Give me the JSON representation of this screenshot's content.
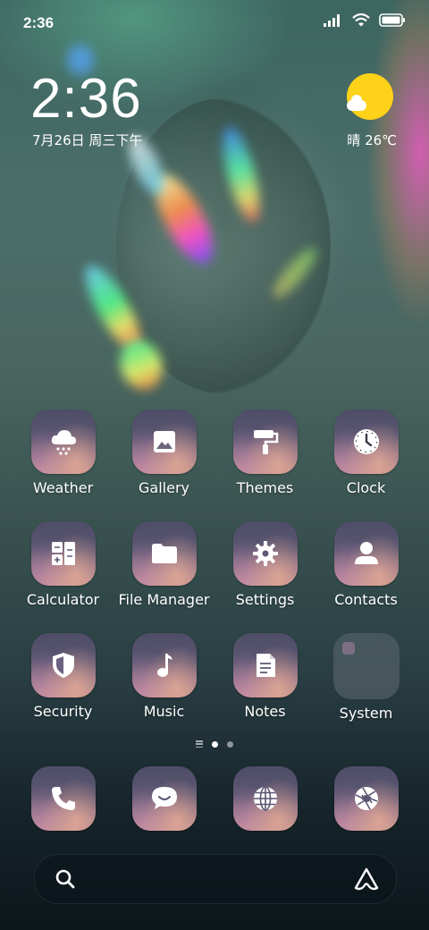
{
  "status_bar": {
    "time": "2:36",
    "icons": [
      "signal-icon",
      "wifi-icon",
      "battery-icon"
    ]
  },
  "clock_widget": {
    "time": "2:36",
    "date": "7月26日 周三下午"
  },
  "weather_widget": {
    "condition_icon": "sun-cloud-icon",
    "text": "晴 26℃"
  },
  "apps": [
    [
      {
        "label": "Weather",
        "icon": "cloud-rain-icon"
      },
      {
        "label": "Gallery",
        "icon": "image-icon"
      },
      {
        "label": "Themes",
        "icon": "paint-roller-icon"
      },
      {
        "label": "Clock",
        "icon": "clock-icon"
      }
    ],
    [
      {
        "label": "Calculator",
        "icon": "calculator-icon"
      },
      {
        "label": "File Manager",
        "icon": "folder-icon"
      },
      {
        "label": "Settings",
        "icon": "gear-icon"
      },
      {
        "label": "Contacts",
        "icon": "person-icon"
      }
    ],
    [
      {
        "label": "Security",
        "icon": "shield-icon"
      },
      {
        "label": "Music",
        "icon": "music-note-icon"
      },
      {
        "label": "Notes",
        "icon": "note-icon"
      },
      {
        "label": "System",
        "icon": "folder-system"
      }
    ]
  ],
  "page_indicator": {
    "pages": 2,
    "active": 1
  },
  "dock": [
    {
      "icon": "phone-icon"
    },
    {
      "icon": "chat-bubble-icon"
    },
    {
      "icon": "globe-icon"
    },
    {
      "icon": "camera-aperture-icon"
    }
  ],
  "search_bar": {
    "left_icon": "search-icon",
    "right_icon": "assistant-icon"
  },
  "colors": {
    "sun": "#ffd21a",
    "tile_top": "#4e4d67",
    "tile_bottom": "#b68b8b"
  }
}
